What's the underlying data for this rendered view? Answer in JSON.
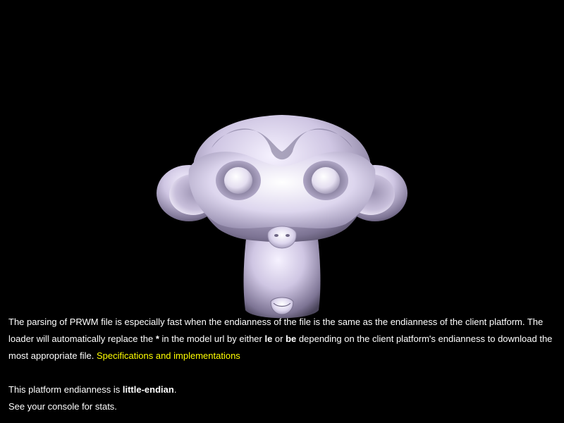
{
  "colors": {
    "background": "#000000",
    "text": "#ffffff",
    "link": "#ffff00",
    "model": "#c9c0de"
  },
  "scene": {
    "model": "monkey-head-icon"
  },
  "info": {
    "para1": {
      "t1": "The parsing of PRWM file is especially fast when the endianness of the file is the same as the endianness of the client platform. The loader will automatically replace the ",
      "star": "*",
      "t2": " in the model url by either ",
      "le": "le",
      "t3": " or ",
      "be": "be",
      "t4": " depending on the client platform's endianness to download the most appropriate file. ",
      "link": "Specifications and implementations"
    },
    "para2": {
      "t1": "This platform endianness is ",
      "value": "little-endian",
      "t2": "."
    },
    "para3": "See your console for stats."
  }
}
